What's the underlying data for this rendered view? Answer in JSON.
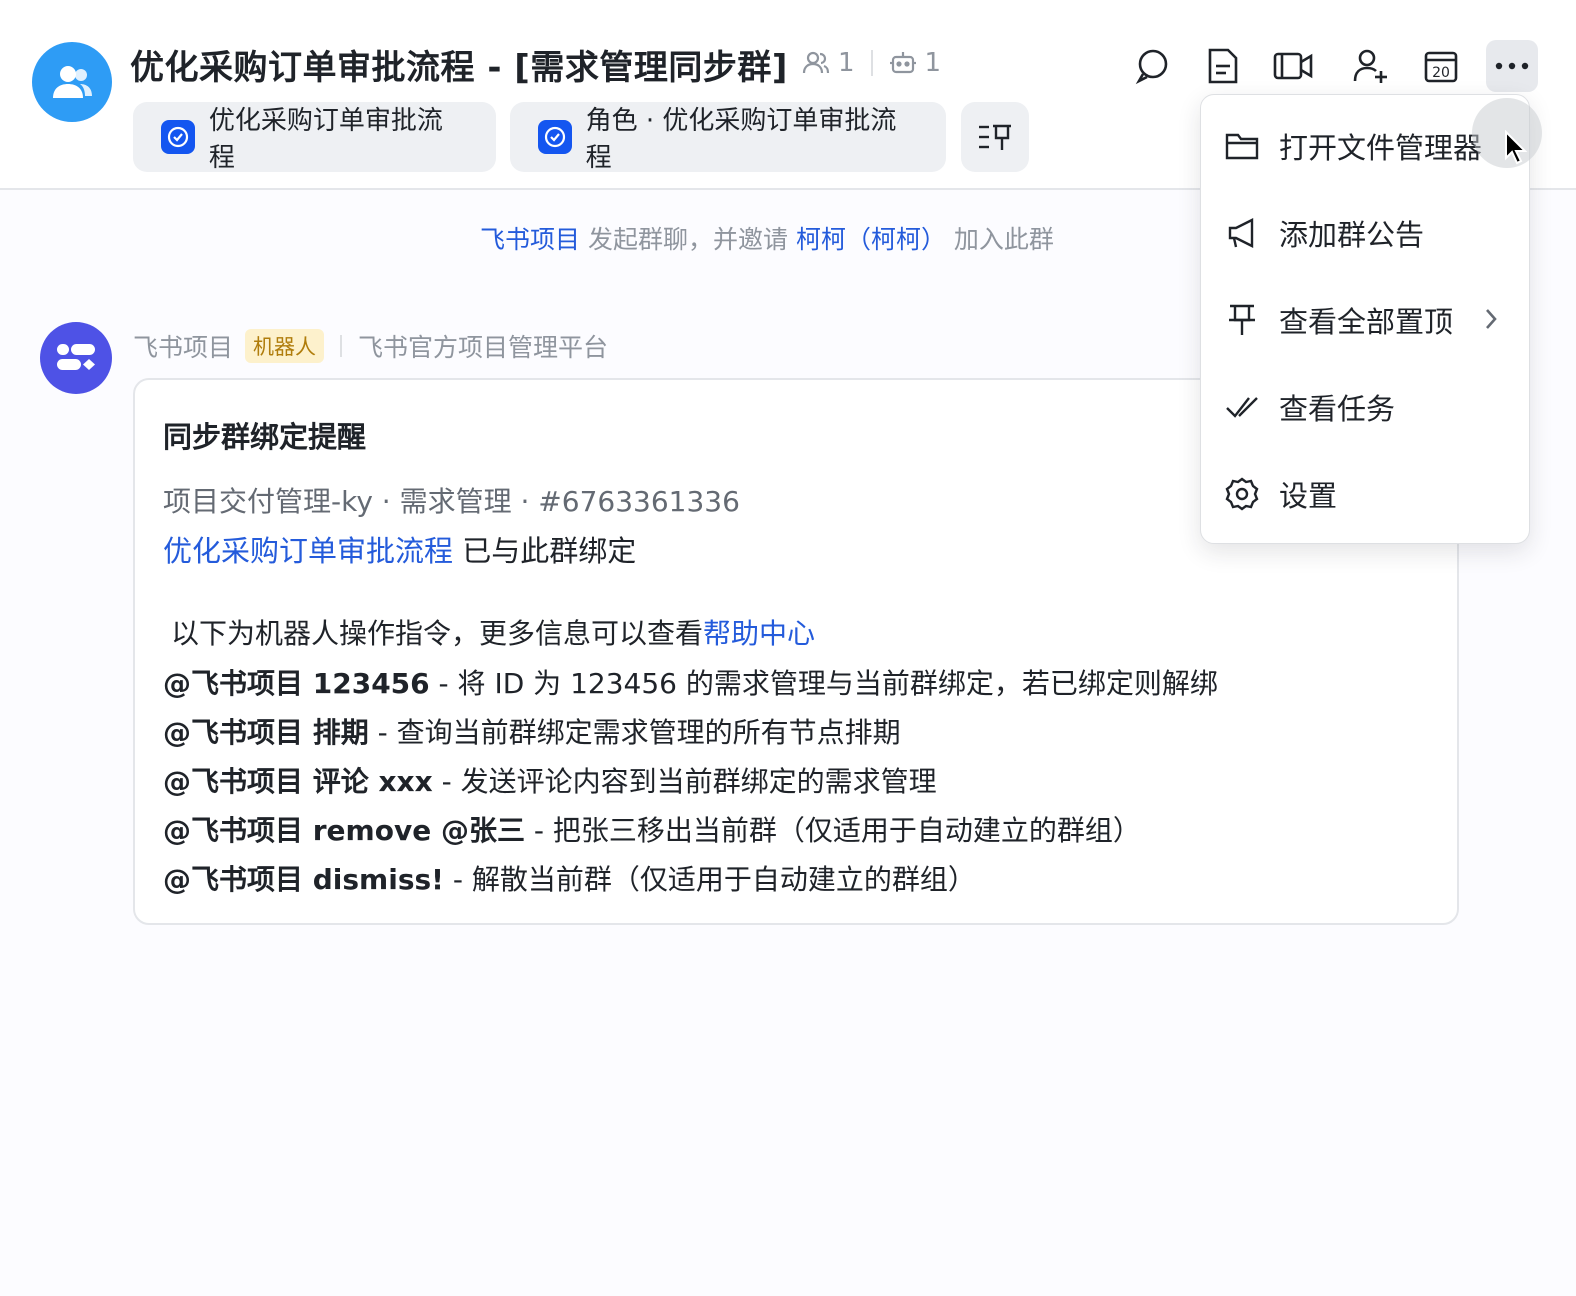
{
  "header": {
    "title": "优化采购订单审批流程 - [需求管理同步群]",
    "member_count": "1",
    "bot_count": "1",
    "chips": [
      {
        "label": "优化采购订单审批流程"
      },
      {
        "label": "角色 · 优化采购订单审批流程"
      }
    ],
    "toolbar_icons": [
      "search-chat-icon",
      "document-icon",
      "video-call-icon",
      "add-member-icon",
      "calendar-icon",
      "more-icon"
    ],
    "calendar_day": "20"
  },
  "system_message": {
    "actor": "飞书项目",
    "action": "发起群聊，并邀请",
    "invitee": "柯柯（柯柯）",
    "suffix": "加入此群"
  },
  "message": {
    "sender": "飞书项目",
    "tag": "机器人",
    "sender_desc": "飞书官方项目管理平台",
    "card": {
      "title": "同步群绑定提醒",
      "subtitle": "项目交付管理-ky · 需求管理 · #6763361336",
      "bind_link": "优化采购订单审批流程",
      "bind_text": " 已与此群绑定",
      "intro_text": "以下为机器人操作指令，更多信息可以查看",
      "intro_link": "帮助中心",
      "commands": [
        {
          "cmd": "@飞书项目 123456",
          "desc": " - 将 ID 为 123456 的需求管理与当前群绑定，若已绑定则解绑"
        },
        {
          "cmd": "@飞书项目 排期",
          "desc": " - 查询当前群绑定需求管理的所有节点排期"
        },
        {
          "cmd": "@飞书项目 评论 xxx",
          "desc": " - 发送评论内容到当前群绑定的需求管理"
        },
        {
          "cmd": "@飞书项目 remove @张三",
          "desc": " - 把张三移出当前群（仅适用于自动建立的群组）"
        },
        {
          "cmd": "@飞书项目 dismiss!",
          "desc": " - 解散当前群（仅适用于自动建立的群组）"
        }
      ]
    }
  },
  "menu": {
    "items": [
      {
        "label": "打开文件管理器",
        "icon": "folder-icon"
      },
      {
        "label": "添加群公告",
        "icon": "megaphone-icon"
      },
      {
        "label": "查看全部置顶",
        "icon": "pin-icon"
      },
      {
        "label": "查看任务",
        "icon": "task-check-icon"
      },
      {
        "label": "设置",
        "icon": "gear-icon"
      }
    ]
  },
  "colors": {
    "link": "#245bdb",
    "accent": "#1456f0",
    "group_avatar": "#2e9cf5",
    "bot_avatar": "#4e52e6"
  }
}
